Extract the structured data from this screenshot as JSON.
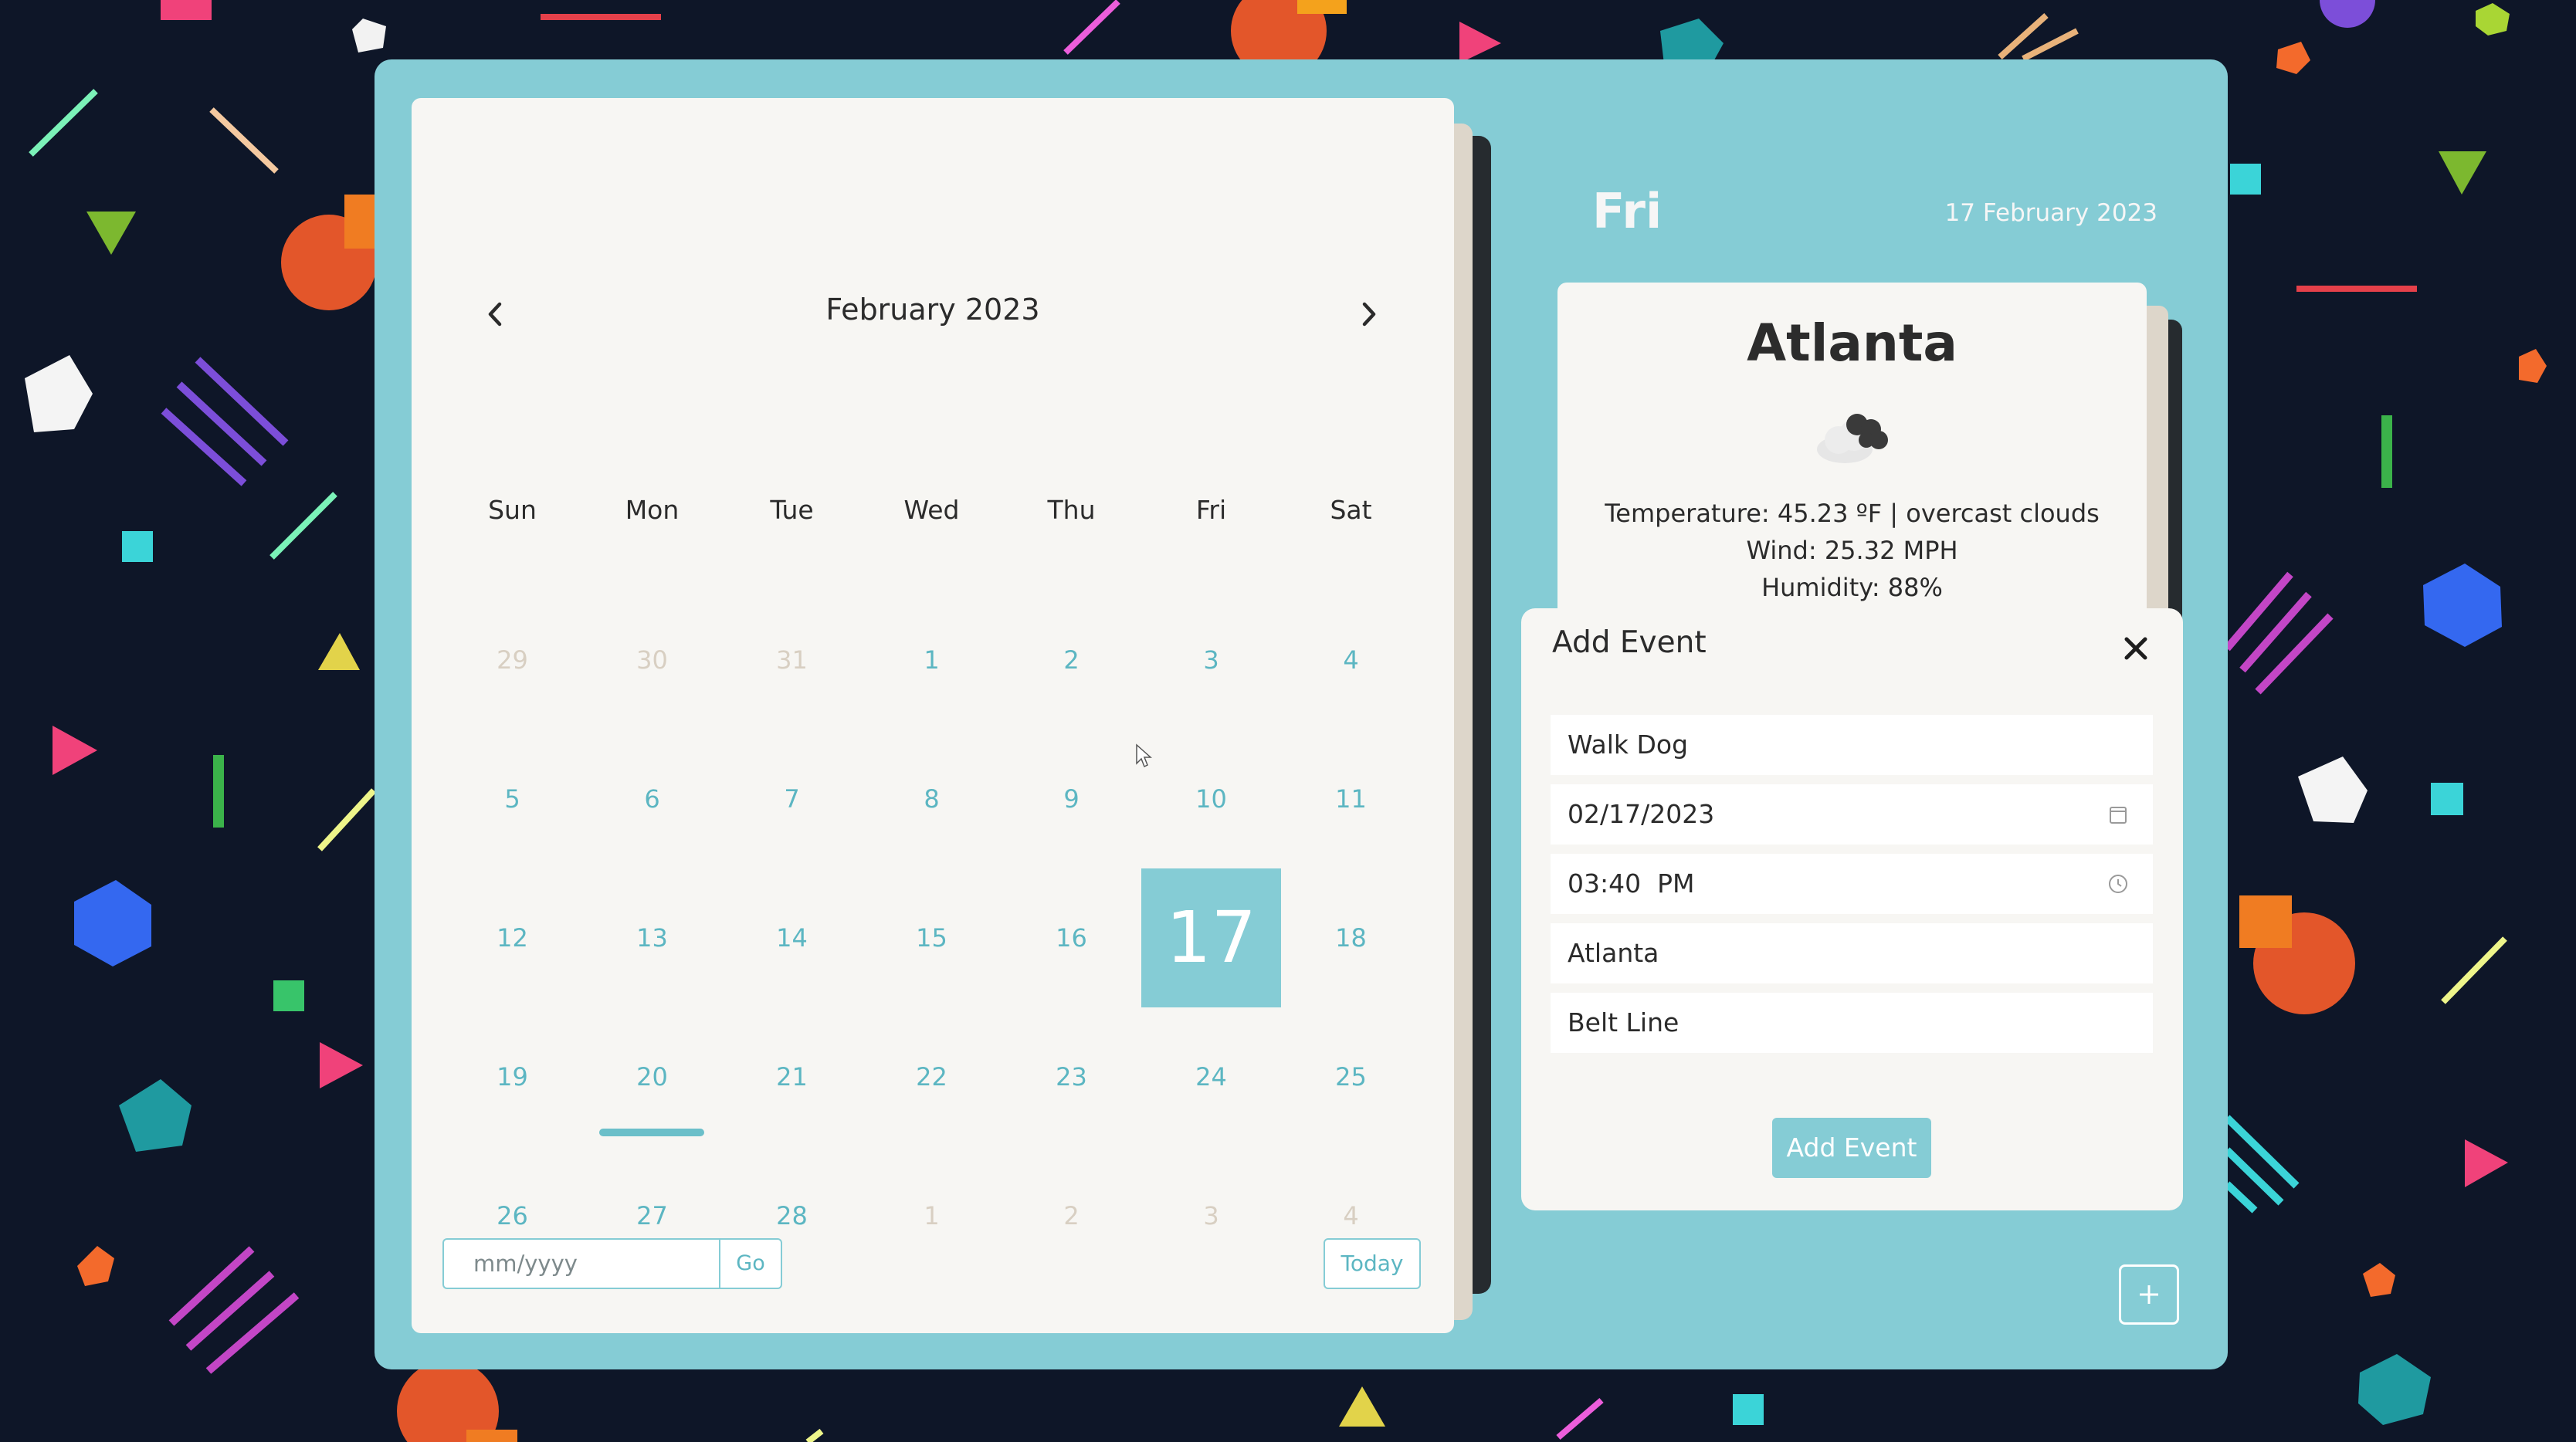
{
  "calendar": {
    "month_title": "February 2023",
    "weekdays": [
      "Sun",
      "Mon",
      "Tue",
      "Wed",
      "Thu",
      "Fri",
      "Sat"
    ],
    "weeks": [
      [
        {
          "d": "29",
          "m": true
        },
        {
          "d": "30",
          "m": true
        },
        {
          "d": "31",
          "m": true
        },
        {
          "d": "1"
        },
        {
          "d": "2"
        },
        {
          "d": "3"
        },
        {
          "d": "4"
        }
      ],
      [
        {
          "d": "5"
        },
        {
          "d": "6"
        },
        {
          "d": "7"
        },
        {
          "d": "8"
        },
        {
          "d": "9"
        },
        {
          "d": "10"
        },
        {
          "d": "11"
        }
      ],
      [
        {
          "d": "12"
        },
        {
          "d": "13"
        },
        {
          "d": "14"
        },
        {
          "d": "15"
        },
        {
          "d": "16"
        },
        {
          "d": "17",
          "sel": true
        },
        {
          "d": "18"
        }
      ],
      [
        {
          "d": "19"
        },
        {
          "d": "20",
          "ev": true
        },
        {
          "d": "21"
        },
        {
          "d": "22"
        },
        {
          "d": "23"
        },
        {
          "d": "24"
        },
        {
          "d": "25"
        }
      ],
      [
        {
          "d": "26"
        },
        {
          "d": "27"
        },
        {
          "d": "28"
        },
        {
          "d": "1",
          "m": true
        },
        {
          "d": "2",
          "m": true
        },
        {
          "d": "3",
          "m": true
        },
        {
          "d": "4",
          "m": true
        }
      ]
    ],
    "prev_icon": "chevron-left-icon",
    "next_icon": "chevron-right-icon",
    "goto_placeholder": "mm/yyyy",
    "go_label": "Go",
    "today_label": "Today"
  },
  "day_panel": {
    "day_name": "Fri",
    "full_date": "17 February 2023"
  },
  "weather": {
    "city": "Atlanta",
    "icon": "cloud-icon",
    "temperature_line": "Temperature: 45.23 ºF | overcast clouds",
    "wind_line": "Wind: 25.32 MPH",
    "humidity_line": "Humidity: 88%"
  },
  "add_event": {
    "title": "Add Event",
    "close_icon": "close-icon",
    "fields": {
      "name": "Walk Dog",
      "date": "02/17/2023",
      "time": "03:40  PM",
      "location": "Atlanta",
      "place": "Belt Line"
    },
    "submit_label": "Add Event"
  },
  "fab": {
    "icon": "plus-icon"
  },
  "colors": {
    "background": "#0e1628",
    "panel": "#85ccd5",
    "card": "#f7f6f3",
    "accent_text": "#5cb6c2",
    "muted_text": "#d8cfc2"
  }
}
